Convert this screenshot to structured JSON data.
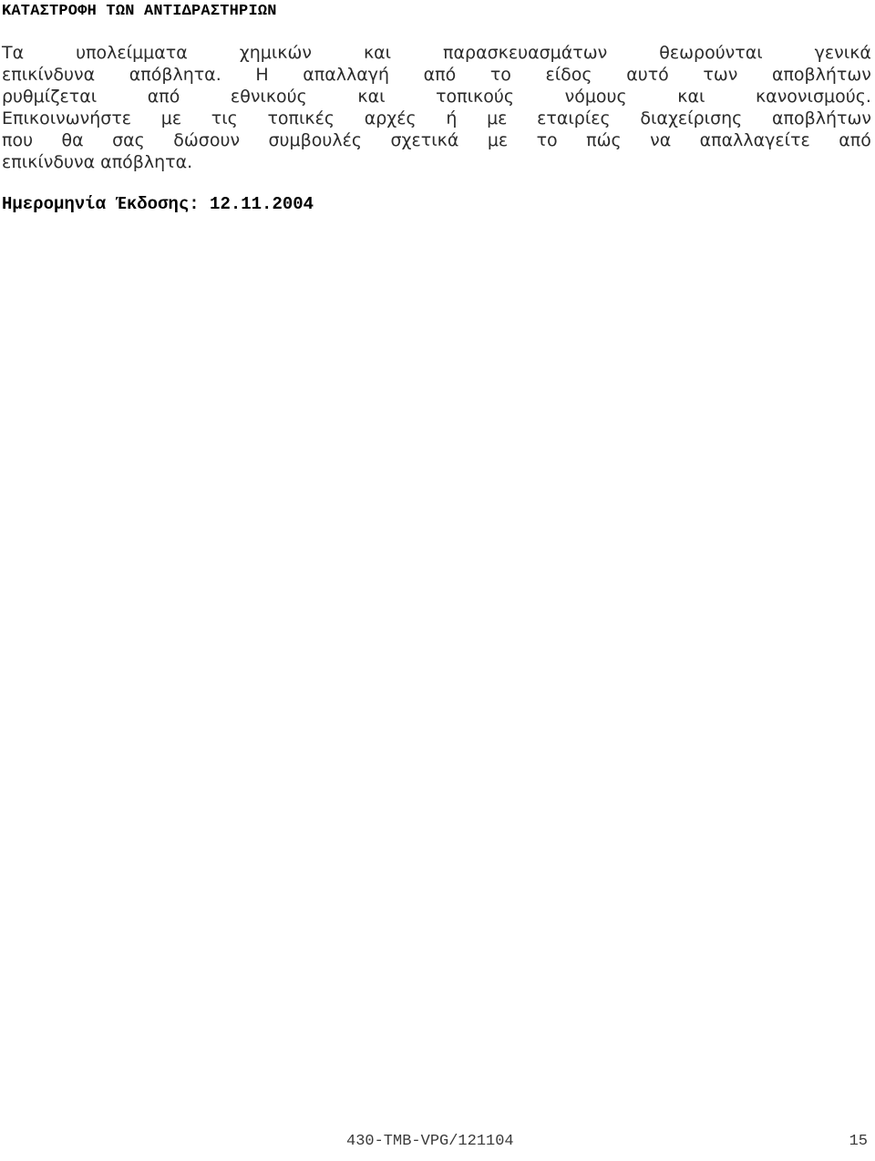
{
  "document": {
    "heading": "ΚΑΤΑΣΤΡΟΦΗ ΤΩΝ ΑΝΤΙΔΡΑΣΤΗΡΙΩΝ",
    "body_lines": [
      {
        "justified": true,
        "words": [
          "Τα",
          "υπολείμματα",
          "χημικών",
          "και",
          "παρασκευασμάτων",
          "θεωρούνται",
          "γενικά"
        ]
      },
      {
        "justified": true,
        "words": [
          "επικίνδυνα",
          "απόβλητα.",
          "Η",
          "απαλλαγή",
          "από",
          "το",
          "είδος",
          "αυτό",
          "των",
          "αποβλήτων"
        ]
      },
      {
        "justified": true,
        "words": [
          "ρυθμίζεται",
          "από",
          "εθνικούς",
          "και",
          "τοπικούς",
          "νόμους",
          "και",
          "κανονισμούς."
        ]
      },
      {
        "justified": true,
        "words": [
          "Επικοινωνήστε",
          "με",
          "τις",
          "τοπικές",
          "αρχές",
          "ή",
          "με",
          "εταιρίες",
          "διαχείρισης",
          "αποβλήτων"
        ]
      },
      {
        "justified": true,
        "words": [
          "που",
          "θα",
          "σας",
          "δώσουν",
          "συμβουλές",
          "σχετικά",
          "με",
          "το",
          "πώς",
          "να",
          "απαλλαγείτε",
          "από"
        ]
      },
      {
        "justified": false,
        "text": "επικίνδυνα απόβλητα."
      }
    ],
    "issue_date_label": "Ημερομηνία Έκδοσης:",
    "issue_date_value": "12.11.2004",
    "issue_date_line": "Ημερομηνία Έκδοσης: 12.11.2004"
  },
  "footer": {
    "document_code": "430-TMB-VPG/121104",
    "page_number": "15"
  },
  "colors": {
    "page_background": "#ffffff",
    "heading_text": "#000000",
    "body_text": "#2b2b2b",
    "footer_text": "#3a3a3a"
  }
}
